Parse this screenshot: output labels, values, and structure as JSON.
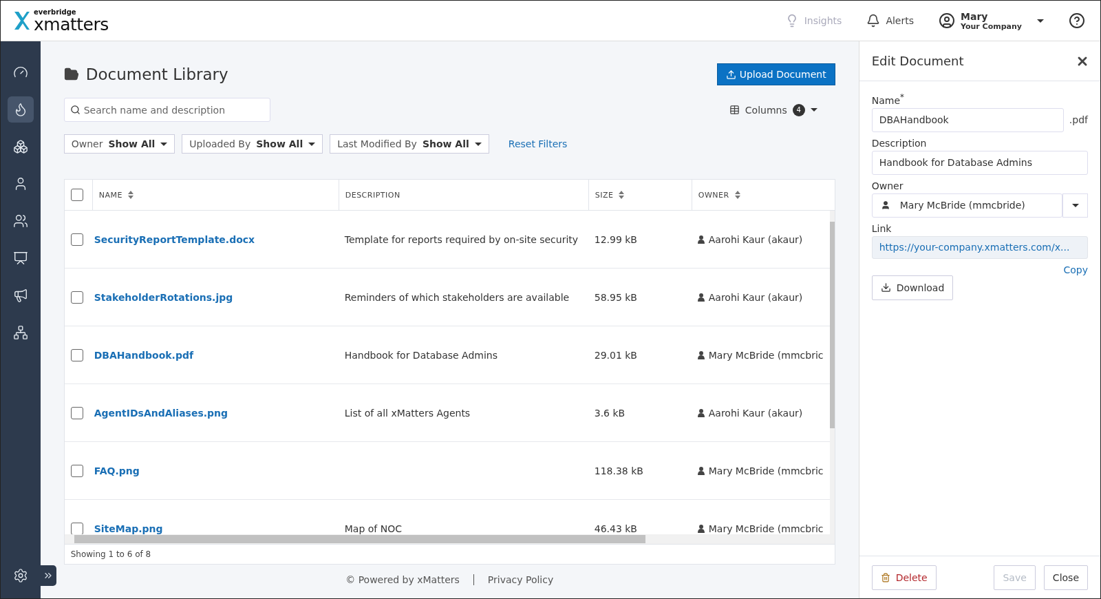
{
  "header": {
    "logo_top": "everbridge",
    "logo_main": "xmatters",
    "insights": "Insights",
    "alerts": "Alerts",
    "user_name": "Mary",
    "user_company": "Your Company"
  },
  "sidebar": {
    "items": [
      {
        "selected": false
      },
      {
        "selected": true
      },
      {
        "selected": false
      },
      {
        "selected": false
      },
      {
        "selected": false
      },
      {
        "selected": false
      },
      {
        "selected": false
      },
      {
        "selected": false
      }
    ]
  },
  "page": {
    "title": "Document Library",
    "upload_button": "Upload Document",
    "search": {
      "placeholder": "Search name and description"
    },
    "columns_button": "Columns",
    "columns_count": "4",
    "filters": [
      {
        "label": "Owner",
        "value": "Show All"
      },
      {
        "label": "Uploaded By",
        "value": "Show All"
      },
      {
        "label": "Last Modified By",
        "value": "Show All"
      }
    ],
    "reset_filters": "Reset Filters"
  },
  "table": {
    "select_all": {
      "checked": false
    },
    "columns": [
      {
        "label": "NAME",
        "sortable": true
      },
      {
        "label": "DESCRIPTION",
        "sortable": false
      },
      {
        "label": "SIZE",
        "sortable": true
      },
      {
        "label": "OWNER",
        "sortable": true
      }
    ],
    "rows": [
      {
        "checked": false,
        "name": "SecurityReportTemplate.docx",
        "description": "Template for reports required by on-site security",
        "size": "12.99 kB",
        "owner": "Aarohi Kaur (akaur)"
      },
      {
        "checked": false,
        "name": "StakeholderRotations.jpg",
        "description": "Reminders of which stakeholders are available",
        "size": "58.95 kB",
        "owner": "Aarohi Kaur (akaur)"
      },
      {
        "checked": false,
        "name": "DBAHandbook.pdf",
        "description": "Handbook for Database Admins",
        "size": "29.01 kB",
        "owner": "Mary McBride (mmcbric"
      },
      {
        "checked": false,
        "name": "AgentIDsAndAliases.png",
        "description": "List of all xMatters Agents",
        "size": "3.6 kB",
        "owner": "Aarohi Kaur (akaur)"
      },
      {
        "checked": false,
        "name": "FAQ.png",
        "description": "",
        "size": "118.38 kB",
        "owner": "Mary McBride (mmcbric"
      },
      {
        "checked": false,
        "name": "SiteMap.png",
        "description": "Map of NOC",
        "size": "46.43 kB",
        "owner": "Mary McBride (mmcbric"
      }
    ],
    "status": "Showing 1 to 6 of 8"
  },
  "footer": {
    "powered": "© Powered by xMatters",
    "privacy": "Privacy Policy"
  },
  "panel": {
    "title": "Edit Document",
    "name_label": "Name",
    "required_mark": "*",
    "name_value": "DBAHandbook",
    "extension": ".pdf",
    "description_label": "Description",
    "description_value": "Handbook for Database Admins",
    "owner_label": "Owner",
    "owner_value": "Mary McBride (mmcbride)",
    "link_label": "Link",
    "link_value": "https://your-company.xmatters.com/x...",
    "copy": "Copy",
    "download": "Download",
    "delete": "Delete",
    "save": "Save",
    "save_disabled": true,
    "close": "Close"
  }
}
